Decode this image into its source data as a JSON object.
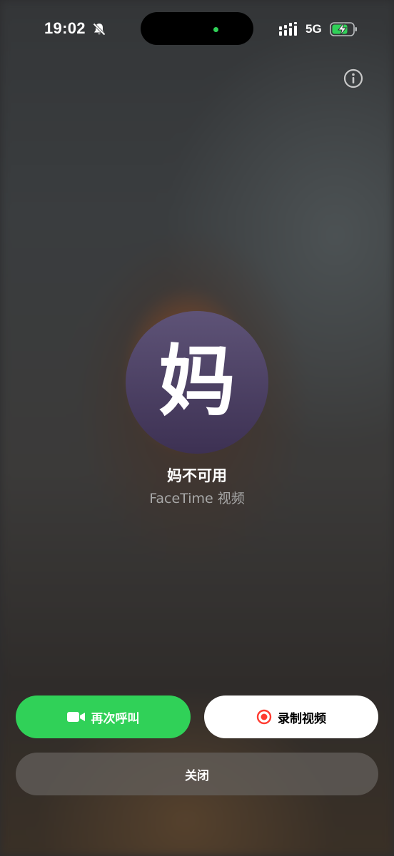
{
  "status_bar": {
    "time": "19:02",
    "network": "5G",
    "icons": [
      "bell-slash-icon",
      "signal-icon",
      "battery-charging-icon"
    ]
  },
  "caller": {
    "avatar_char": "妈",
    "status": "妈不可用",
    "call_type": "FaceTime 视频"
  },
  "actions": {
    "callback_label": "再次呼叫",
    "record_label": "录制视频",
    "close_label": "关闭"
  },
  "colors": {
    "green": "#30d158",
    "red": "#ff3b30",
    "avatar": "#4a3f63"
  }
}
